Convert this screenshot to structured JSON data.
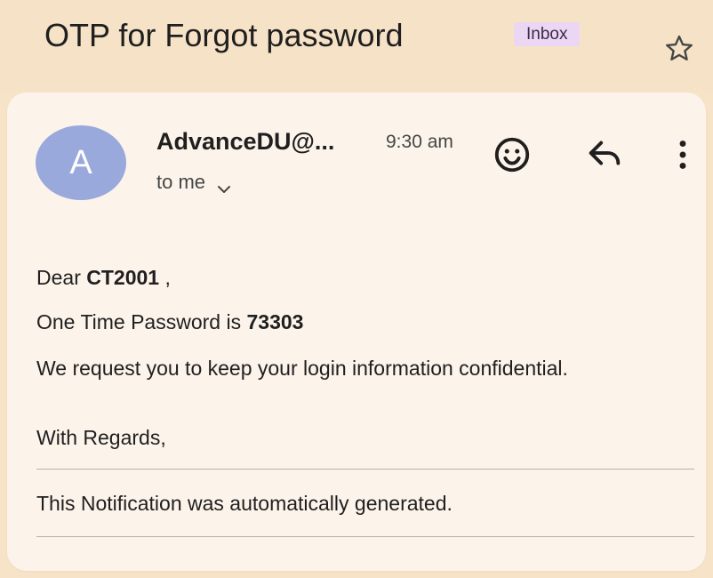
{
  "email": {
    "subject": "OTP for Forgot password",
    "label": "Inbox",
    "sender": {
      "avatar_letter": "A",
      "name": "AdvanceDU@...",
      "time": "9:30 am",
      "recipient": "to me"
    },
    "body": {
      "greeting_prefix": "Dear",
      "user_id": "CT2001",
      "greeting_suffix": " ,",
      "otp_prefix": "One Time Password is",
      "otp_code": "73303",
      "request": "We request you to keep your login information confidential.",
      "regards": "With Regards,",
      "footer": "This Notification was automatically generated."
    }
  },
  "icons": {
    "star": "star-icon",
    "emoji": "add-reaction-icon",
    "reply": "reply-icon",
    "more": "more-vertical-icon",
    "expand": "chevron-down-icon"
  },
  "colors": {
    "header_background": "#f6e2c6",
    "card_background": "#fcf3ea",
    "avatar": "#9aa9dc",
    "label_badge": "#ebd6f4"
  }
}
